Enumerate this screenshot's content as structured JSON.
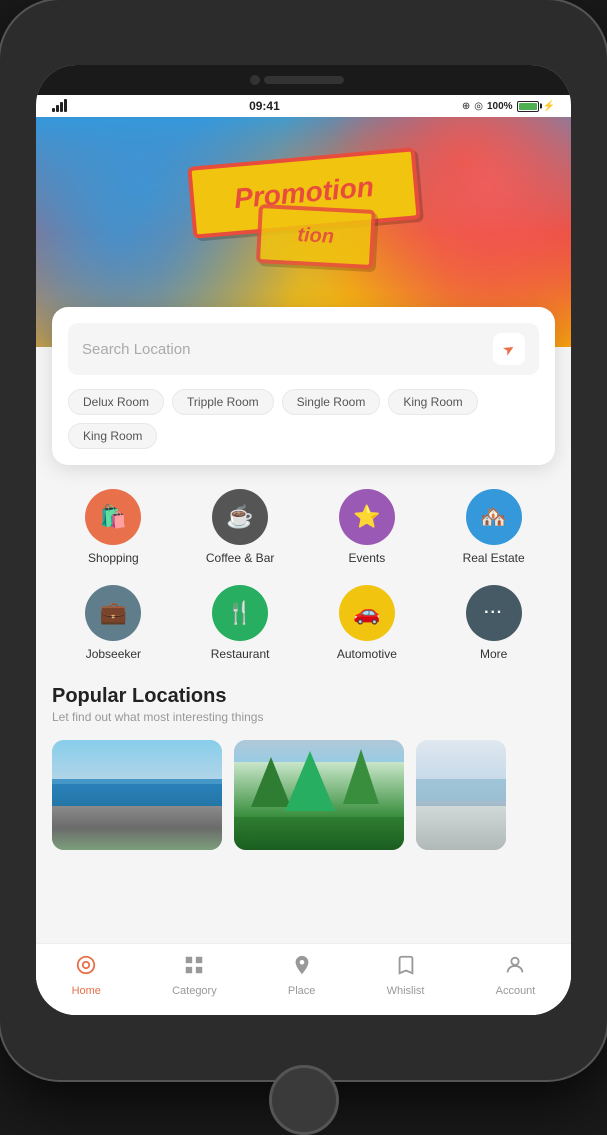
{
  "phone": {
    "status_bar": {
      "time": "09:41",
      "battery": "100%",
      "signal_bars": [
        4,
        7,
        10,
        13,
        16
      ]
    }
  },
  "hero": {
    "promo_text": "Promotion",
    "promo_text2": "tion",
    "dots": [
      {
        "active": true
      },
      {
        "active": false
      },
      {
        "active": false
      }
    ]
  },
  "search": {
    "placeholder": "Search Location",
    "tags": [
      "Delux Room",
      "Tripple Room",
      "Single Room",
      "King Room",
      "King Room"
    ]
  },
  "categories": [
    {
      "label": "Shopping",
      "icon": "🛍️",
      "color": "#e8704a"
    },
    {
      "label": "Coffee & Bar",
      "icon": "☕",
      "color": "#555"
    },
    {
      "label": "Events",
      "icon": "⭐",
      "color": "#9b59b6"
    },
    {
      "label": "Real Estate",
      "icon": "🏠",
      "color": "#3498db"
    },
    {
      "label": "Jobseeker",
      "icon": "💼",
      "color": "#607d8b"
    },
    {
      "label": "Restaurant",
      "icon": "🍴",
      "color": "#27ae60"
    },
    {
      "label": "Automotive",
      "icon": "🚗",
      "color": "#f1c40f"
    },
    {
      "label": "More",
      "icon": "•••",
      "color": "#455a64"
    }
  ],
  "popular": {
    "title": "Popular Locations",
    "subtitle": "Let find out what most interesting things"
  },
  "bottom_nav": [
    {
      "label": "Home",
      "icon": "⊕",
      "active": true
    },
    {
      "label": "Category",
      "icon": "❏",
      "active": false
    },
    {
      "label": "Place",
      "icon": "📍",
      "active": false
    },
    {
      "label": "Whislist",
      "icon": "🔖",
      "active": false
    },
    {
      "label": "Account",
      "icon": "👤",
      "active": false
    }
  ]
}
